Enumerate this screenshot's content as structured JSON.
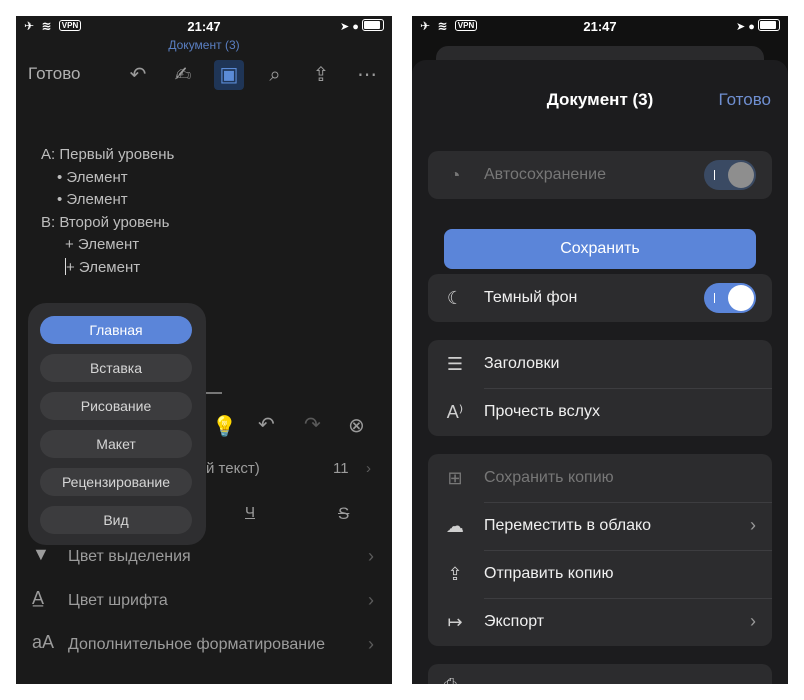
{
  "status": {
    "time": "21:47",
    "vpn": "VPN"
  },
  "left": {
    "doc_title": "Документ (3)",
    "done_label": "Готово",
    "document_lines": [
      "A: Первый уровень",
      "• Элемент",
      "• Элемент",
      "B: Второй уровень",
      "+ Элемент",
      "+ Элемент"
    ],
    "tab_menu": [
      "Главная",
      "Вставка",
      "Рисование",
      "Макет",
      "Рецензирование",
      "Вид"
    ],
    "selected_tab": "Главная",
    "partial_font_text": "й текст)",
    "font_size": "11",
    "underline_glyph": "Ч",
    "strike_glyph": "S",
    "format_rows": [
      "Цвет выделения",
      "Цвет шрифта",
      "Дополнительное форматирование"
    ]
  },
  "right": {
    "title": "Документ (3)",
    "done_label": "Готово",
    "autosave_label": "Автосохранение",
    "save_button": "Сохранить",
    "dark_bg_label": "Темный фон",
    "headings_label": "Заголовки",
    "read_aloud_label": "Прочесть вслух",
    "save_copy_label": "Сохранить копию",
    "move_cloud_label": "Переместить в облако",
    "send_copy_label": "Отправить копию",
    "export_label": "Экспорт",
    "autosave_on": true,
    "dark_bg_on": true
  },
  "colors": {
    "accent": "#5b85d9",
    "background": "#1c1c1e"
  }
}
